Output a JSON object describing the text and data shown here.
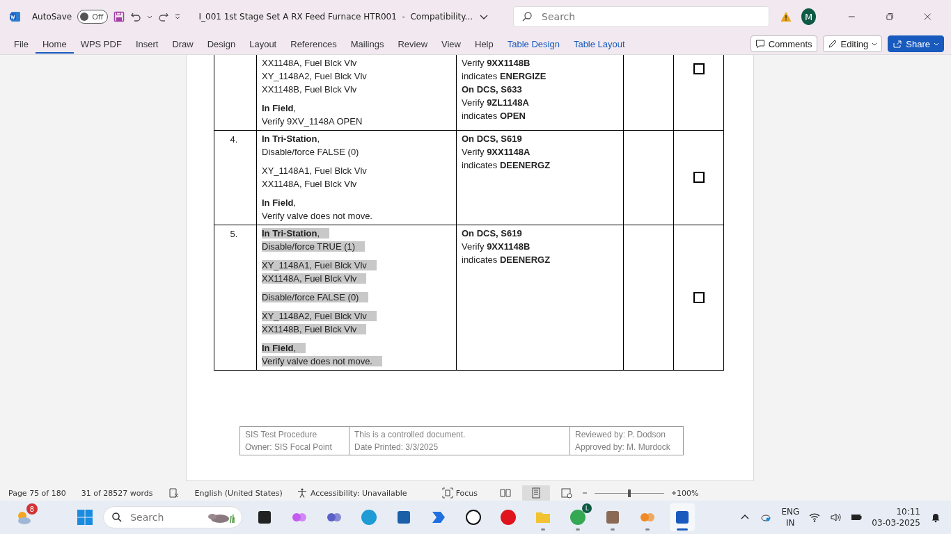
{
  "titlebar": {
    "autosave_label": "AutoSave",
    "autosave_state": "Off",
    "autosave_on": false,
    "title": "I_001 1st Stage Set A RX Feed Furnace HTR001  -  Compatibility...",
    "search_placeholder": "Search",
    "avatar": "M"
  },
  "ribbon": {
    "tabs": [
      {
        "label": "File",
        "selected": false,
        "contextual": false
      },
      {
        "label": "Home",
        "selected": true,
        "contextual": false
      },
      {
        "label": "WPS PDF",
        "selected": false,
        "contextual": false
      },
      {
        "label": "Insert",
        "selected": false,
        "contextual": false
      },
      {
        "label": "Draw",
        "selected": false,
        "contextual": false
      },
      {
        "label": "Design",
        "selected": false,
        "contextual": false
      },
      {
        "label": "Layout",
        "selected": false,
        "contextual": false
      },
      {
        "label": "References",
        "selected": false,
        "contextual": false
      },
      {
        "label": "Mailings",
        "selected": false,
        "contextual": false
      },
      {
        "label": "Review",
        "selected": false,
        "contextual": false
      },
      {
        "label": "View",
        "selected": false,
        "contextual": false
      },
      {
        "label": "Help",
        "selected": false,
        "contextual": false
      },
      {
        "label": "Table Design",
        "selected": false,
        "contextual": true
      },
      {
        "label": "Table Layout",
        "selected": false,
        "contextual": true
      }
    ],
    "comments": "Comments",
    "editing": "Editing",
    "share": "Share"
  },
  "table": {
    "rows": [
      {
        "step": [
          [
            "XX1148A, Fuel Blck Vlv",
            "XY_1148A2, Fuel Blck Vlv",
            "XX1148B, Fuel Blck Vlv"
          ],
          [
            "**In Field**,",
            "Verify 9XV_1148A OPEN"
          ]
        ],
        "verify": [
          {
            "kind": "line",
            "text": "Verify **9XX1148B**"
          },
          {
            "kind": "line",
            "text": " indicates **ENERGIZE**"
          },
          {
            "kind": "heading",
            "text": "On DCS, S633"
          },
          {
            "kind": "line",
            "text": "Verify **9ZL1148A**"
          },
          {
            "kind": "line",
            "text": " indicates **OPEN**"
          }
        ],
        "highlighted": false,
        "checked": false
      },
      {
        "number": "4.",
        "step": [
          [
            "**In Tri-Station**,",
            "Disable/force FALSE (0)"
          ],
          [
            "XY_1148A1, Fuel Blck Vlv",
            "XX1148A, Fuel Blck Vlv"
          ],
          [
            "**In Field**,",
            "Verify valve does not move."
          ]
        ],
        "verify": [
          {
            "kind": "heading",
            "text": "On DCS, S619"
          },
          {
            "kind": "line",
            "text": "Verify **9XX1148A**"
          },
          {
            "kind": "line",
            "text": " indicates **DEENERGZ**"
          }
        ],
        "highlighted": false,
        "checked": false
      },
      {
        "number": "5.",
        "step": [
          [
            "**In Tri-Station**,",
            "Disable/force TRUE (1)"
          ],
          [
            "XY_1148A1, Fuel Blck Vlv",
            "XX1148A, Fuel Blck Vlv"
          ],
          [
            "Disable/force FALSE (0)"
          ],
          [
            "XY_1148A2, Fuel Blck Vlv",
            "XX1148B, Fuel Blck Vlv"
          ],
          [
            "**In Field**,",
            "Verify valve does not move."
          ]
        ],
        "verify": [
          {
            "kind": "heading",
            "text": "On DCS, S619"
          },
          {
            "kind": "line",
            "text": "Verify **9XX1148B**"
          },
          {
            "kind": "line",
            "text": " indicates **DEENERGZ**"
          }
        ],
        "highlighted": true,
        "checked": false
      }
    ]
  },
  "footer": [
    [
      "SIS Test Procedure",
      "Owner: SIS Focal Point"
    ],
    [
      "This is a controlled document.",
      "Date Printed: 3/3/2025"
    ],
    [
      "Reviewed by: P. Dodson",
      "Approved by: M. Murdock"
    ]
  ],
  "status_bar": {
    "page": "Page 75 of 180",
    "words": "31 of 28527 words",
    "language": "English (United States)",
    "accessibility": "Accessibility: Unavailable",
    "focus": "Focus",
    "zoom": {
      "level": 0.5
    },
    "zoom_reading": "100%"
  },
  "taskbar": {
    "weather_badge": "8",
    "search_placeholder": "Search",
    "apps": [
      {
        "kind": "terminal",
        "running": false
      },
      {
        "kind": "copilot",
        "running": false
      },
      {
        "kind": "teams",
        "running": false
      },
      {
        "kind": "edge",
        "running": false
      },
      {
        "kind": "store",
        "running": false
      },
      {
        "kind": "automate",
        "running": false
      },
      {
        "kind": "dell",
        "running": false
      },
      {
        "kind": "opera",
        "running": false
      },
      {
        "kind": "folder",
        "running": true
      },
      {
        "kind": "chrome",
        "running": true,
        "badge": "L"
      },
      {
        "kind": "contact",
        "running": true
      },
      {
        "kind": "puzzle",
        "running": true
      },
      {
        "kind": "word",
        "running": true,
        "active": true
      }
    ],
    "language": "ENG",
    "region": "IN",
    "time": "10:11",
    "date": "03-03-2025"
  }
}
